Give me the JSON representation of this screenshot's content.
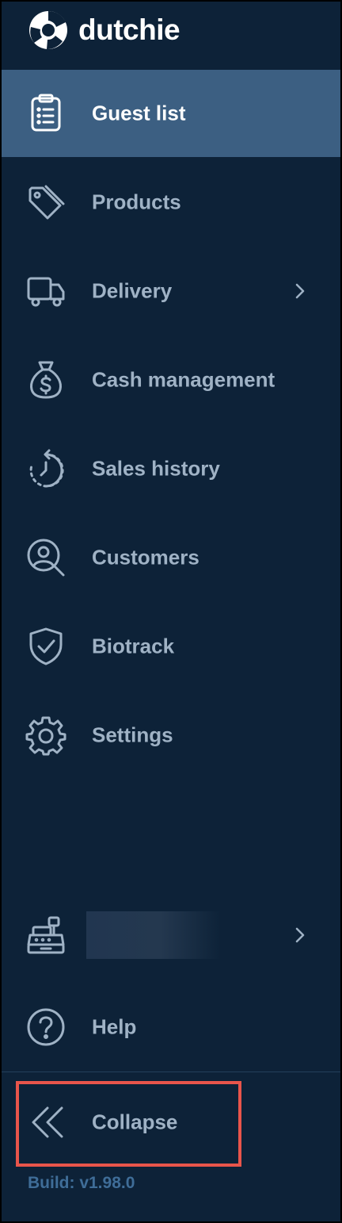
{
  "brand": {
    "name": "dutchie"
  },
  "nav": {
    "items": [
      {
        "label": "Guest list",
        "icon": "clipboard-list-icon",
        "active": true
      },
      {
        "label": "Products",
        "icon": "tags-icon"
      },
      {
        "label": "Delivery",
        "icon": "truck-icon",
        "has_submenu": true
      },
      {
        "label": "Cash management",
        "icon": "money-bag-icon"
      },
      {
        "label": "Sales history",
        "icon": "history-clock-icon"
      },
      {
        "label": "Customers",
        "icon": "user-search-icon"
      },
      {
        "label": "Biotrack",
        "icon": "shield-check-icon"
      },
      {
        "label": "Settings",
        "icon": "gear-icon"
      }
    ]
  },
  "register": {
    "icon": "cash-register-icon",
    "name_redacted": true,
    "has_submenu": true
  },
  "help": {
    "label": "Help",
    "icon": "help-circle-icon"
  },
  "collapse": {
    "label": "Collapse",
    "icon": "double-chevron-left-icon",
    "highlighted": true
  },
  "build": {
    "label": "Build: v1.98.0"
  },
  "colors": {
    "sidebar_bg": "#0d2238",
    "active_bg": "#3c5f82",
    "text_inactive": "#9fb2c5",
    "text_active": "#ffffff",
    "highlight": "#e8554b",
    "build_text": "#3f6d98"
  }
}
